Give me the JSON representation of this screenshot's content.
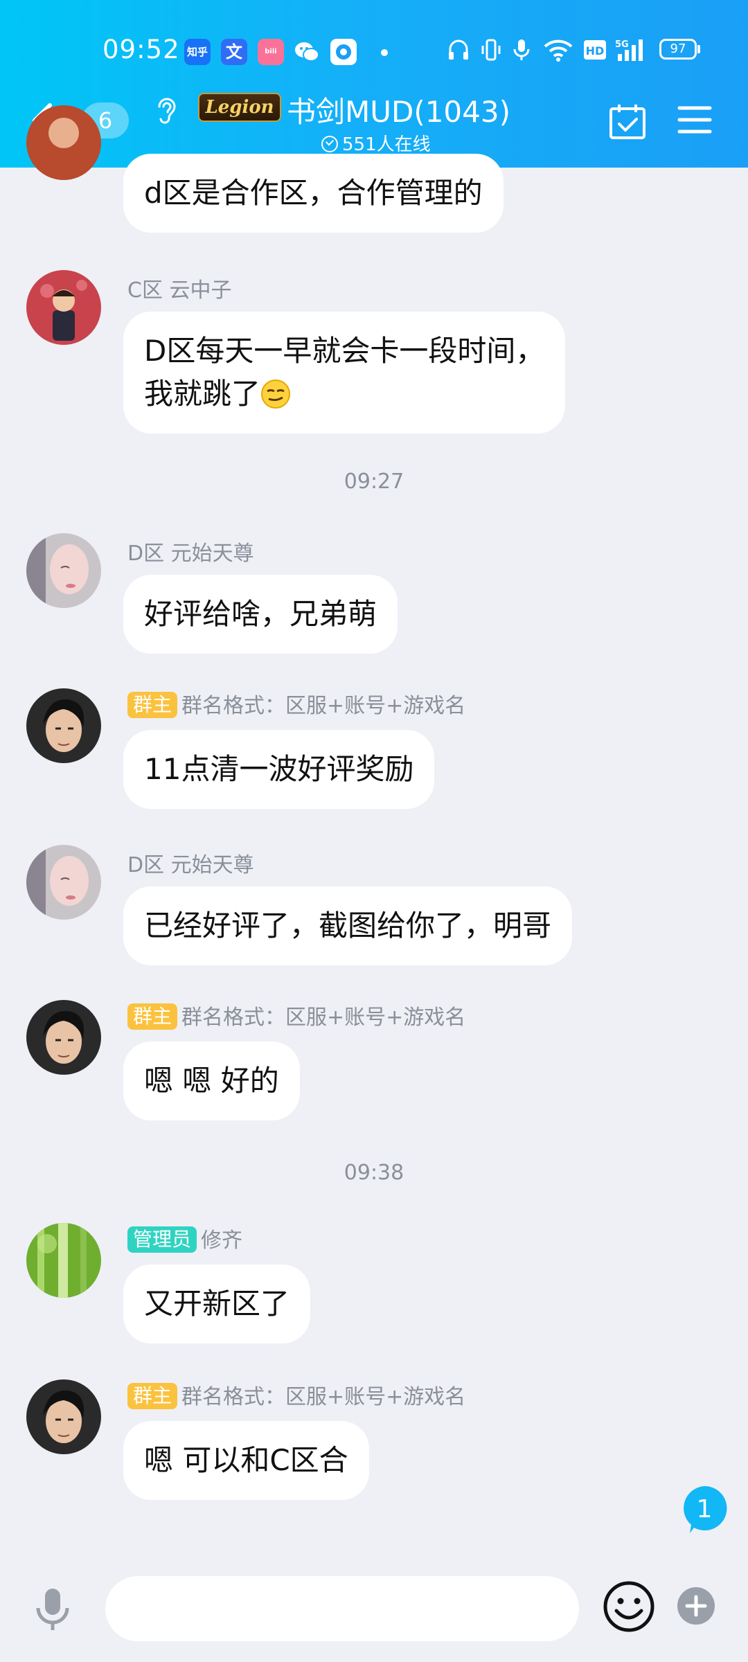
{
  "status_bar": {
    "time": "09:52",
    "apps": [
      "知乎",
      "文",
      "bili"
    ],
    "battery": "97",
    "network": "5G"
  },
  "header": {
    "unread_count": "6",
    "logo_text": "Legion",
    "title": "书剑MUD(1043)",
    "online_text": "551人在线"
  },
  "messages": [
    {
      "sender": "",
      "tag": "",
      "lines": [
        "d区是合作区，合作管理的"
      ]
    },
    {
      "sender": "C区 云中子",
      "tag": "",
      "lines": [
        "D区每天一早就会卡一段时间，",
        "我就跳了"
      ]
    },
    {
      "sender": "D区 元始天尊",
      "tag": "",
      "lines": [
        "好评给啥，兄弟萌"
      ]
    },
    {
      "sender": "群名格式：区服+账号+游戏名",
      "tag": "群主",
      "lines": [
        "11点清一波好评奖励"
      ]
    },
    {
      "sender": "D区 元始天尊",
      "tag": "",
      "lines": [
        "已经好评了，截图给你了，明哥"
      ]
    },
    {
      "sender": "群名格式：区服+账号+游戏名",
      "tag": "群主",
      "lines": [
        "嗯 嗯 好的"
      ]
    },
    {
      "sender": "修齐",
      "tag": "管理员",
      "lines": [
        "又开新区了"
      ]
    },
    {
      "sender": "群名格式：区服+账号+游戏名",
      "tag": "群主",
      "lines": [
        "嗯 可以和C区合"
      ]
    }
  ],
  "timestamps": [
    "09:27",
    "09:38"
  ],
  "new_message_badge": "1",
  "input": {
    "placeholder": "",
    "value": ""
  },
  "colors": {
    "header_start": "#00c6f6",
    "header_end": "#1a9ff6",
    "chat_bg": "#eef0f6",
    "owner_tag": "#fbc23f",
    "admin_tag": "#2fd3c1",
    "badge": "#12b7f5"
  },
  "icons": {
    "back": "chevron-left-icon",
    "ear": "ear-icon",
    "calendar": "calendar-check-icon",
    "menu": "hamburger-menu-icon",
    "mic": "microphone-icon",
    "emoji": "smiley-icon",
    "plus": "plus-icon"
  }
}
